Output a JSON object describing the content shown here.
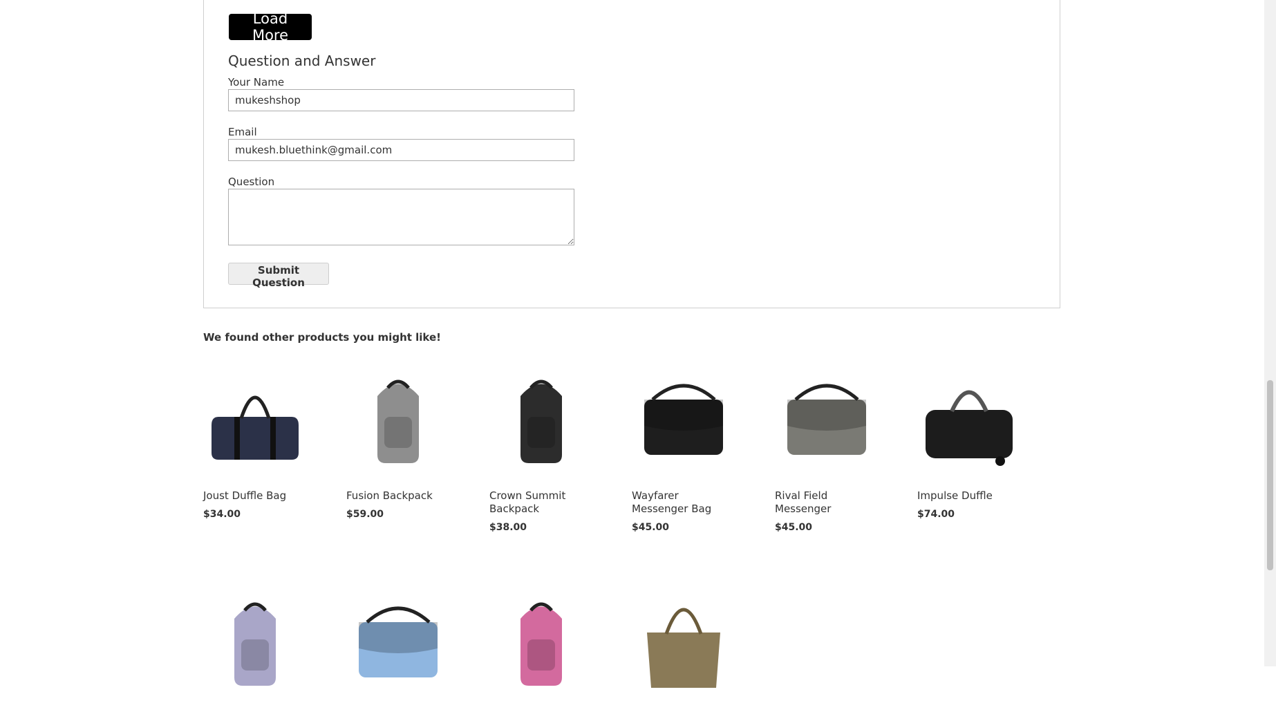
{
  "qa": {
    "load_more_label": "Load More",
    "heading": "Question and Answer",
    "name_label": "Your Name",
    "name_value": "mukeshshop",
    "email_label": "Email",
    "email_value": "mukesh.bluethink@gmail.com",
    "question_label": "Question",
    "question_value": "",
    "submit_label": "Submit Question"
  },
  "related": {
    "title": "We found other products you might like!",
    "products": [
      {
        "name": "Joust Duffle Bag",
        "price": "$34.00",
        "icon": "duffle-bag-icon",
        "color": "#2b3148"
      },
      {
        "name": "Fusion Backpack",
        "price": "$59.00",
        "icon": "backpack-icon",
        "color": "#8e8e8e"
      },
      {
        "name": "Crown Summit Backpack",
        "price": "$38.00",
        "icon": "backpack-icon",
        "color": "#2c2c2c"
      },
      {
        "name": "Wayfarer Messenger Bag",
        "price": "$45.00",
        "icon": "messenger-bag-icon",
        "color": "#1e1e1e"
      },
      {
        "name": "Rival Field Messenger",
        "price": "$45.00",
        "icon": "messenger-bag-icon",
        "color": "#7a7a74"
      },
      {
        "name": "Impulse Duffle",
        "price": "$74.00",
        "icon": "rolling-duffle-icon",
        "color": "#1c1c1c"
      },
      {
        "name": "",
        "price": "",
        "icon": "backpack-icon",
        "color": "#a9a6c8"
      },
      {
        "name": "",
        "price": "",
        "icon": "messenger-bag-icon",
        "color": "#8fb6e0"
      },
      {
        "name": "",
        "price": "",
        "icon": "backpack-icon",
        "color": "#d36a9e"
      },
      {
        "name": "",
        "price": "",
        "icon": "tote-bag-icon",
        "color": "#8a7a57"
      }
    ]
  }
}
